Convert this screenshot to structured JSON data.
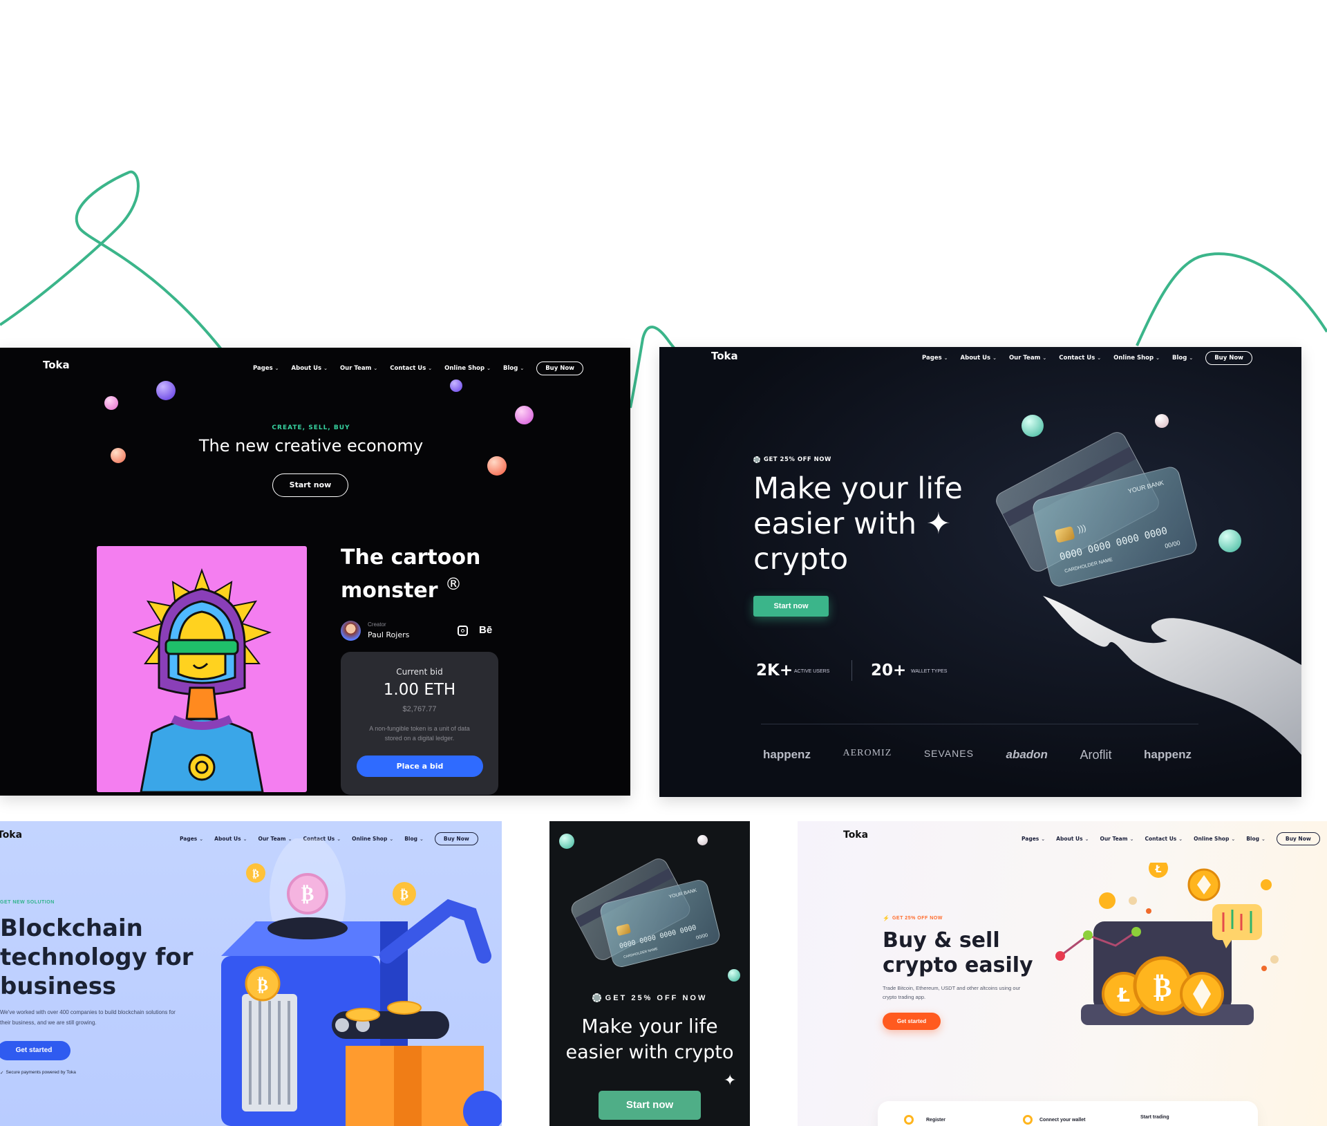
{
  "nav": {
    "logo": "Toka",
    "items": [
      "Pages",
      "About Us",
      "Our Team",
      "Contact Us",
      "Online Shop",
      "Blog"
    ],
    "buy": "Buy Now"
  },
  "nft": {
    "kicker": "CREATE, SELL, BUY",
    "headline": "The new creative economy",
    "start": "Start now",
    "title_line1": "The cartoon",
    "title_line2": "monster",
    "registered": "®",
    "creator_label": "Creator",
    "creator_name": "Paul Rojers",
    "behance": "Bē",
    "bid_label": "Current bid",
    "bid_value": "1.00 ETH",
    "bid_usd": "$2,767.77",
    "bid_desc_1": "A non-fungible token is a unit of data",
    "bid_desc_2": "stored on a digital ledger.",
    "bid_button": "Place a bid"
  },
  "crypto": {
    "badge": "GET 25% OFF NOW",
    "h1": "Make your life",
    "h2": "easier with",
    "h3": "crypto",
    "cta": "Start now",
    "stat1_value": "2K+",
    "stat1_label": "ACTIVE USERS",
    "stat2_value": "20+",
    "stat2_label": "WALLET TYPES",
    "card_bank": "YOUR BANK",
    "card_number": "0000 0000 0000 0000",
    "card_holder": "CARDHOLDER NAME",
    "card_exp": "00/00",
    "brands": [
      "happenz",
      "AEROMIZ",
      "SEVANES",
      "abadon",
      "Aroflit",
      "happenz"
    ]
  },
  "blockchain": {
    "kicker": "GET NEW SOLUTION",
    "h1": "Blockchain",
    "h2": "technology for",
    "h3": "business",
    "desc1": "We've worked with over 400 companies to build blockchain solutions for",
    "desc2": "their business, and we are still growing.",
    "cta": "Get started",
    "secure": "Secure payments powered by Toka"
  },
  "mobile": {
    "badge": "GET 25% OFF NOW",
    "h1": "Make your life",
    "h2": "easier with crypto",
    "cta": "Start now"
  },
  "buysell": {
    "badge": "GET 25% OFF NOW",
    "h1": "Buy & sell",
    "h2": "crypto easily",
    "desc1": "Trade Bitcoin, Ethereum, USDT and other altcoins using our",
    "desc2": "crypto trading app.",
    "cta": "Get started",
    "steps": [
      "Register",
      "Connect your wallet",
      "Start trading"
    ]
  },
  "colors": {
    "accent_green": "#3bb58a",
    "nft_blue": "#2f6bff",
    "blockchain_blue": "#2f5bf0",
    "orange": "#ff5a1f",
    "panel_dark": "#0a0a0e",
    "panel_navy": "#0d111c"
  }
}
